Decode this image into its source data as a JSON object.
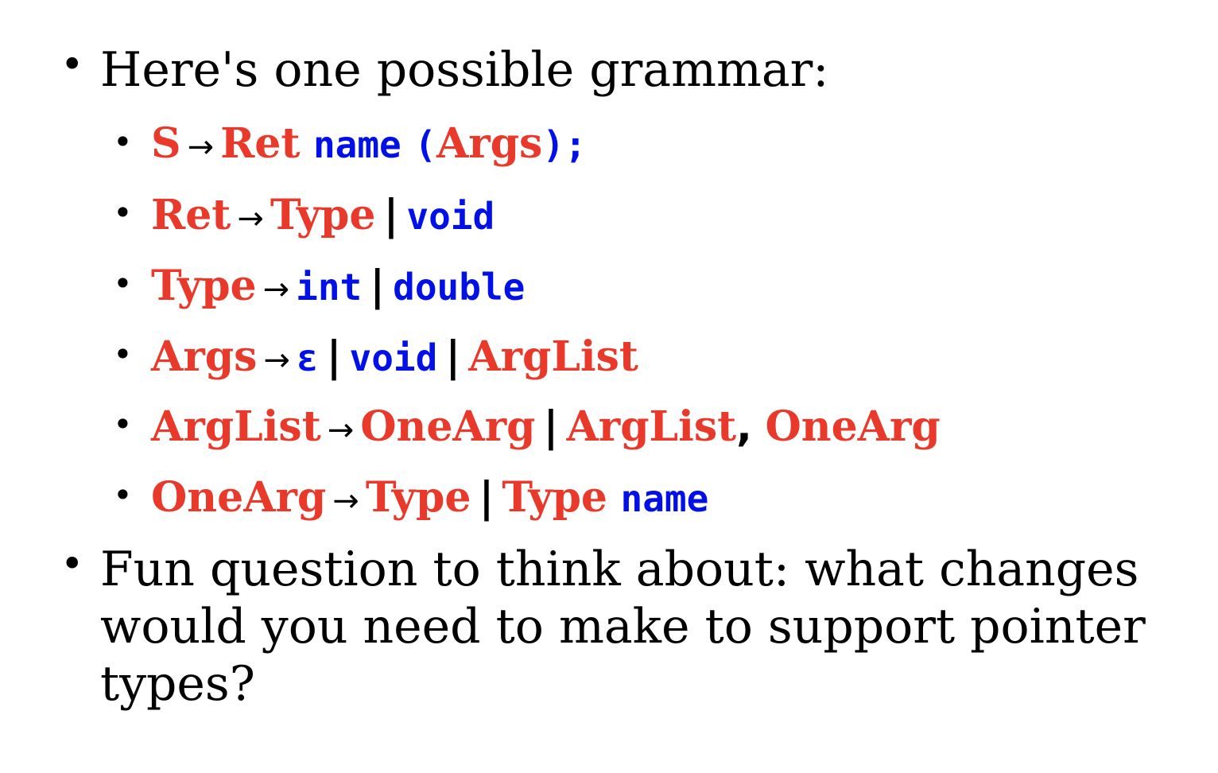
{
  "bullets": {
    "intro": "Here's one possible grammar:",
    "question": "Fun question to think about: what changes would you need to make to support pointer types?"
  },
  "grammar": {
    "arrow": "→",
    "bar": "|",
    "comma": ",",
    "rule1": {
      "lhs": "S",
      "ret": "Ret",
      "name": "name",
      "lparen": "(",
      "args": "Args",
      "rparen": ");"
    },
    "rule2": {
      "lhs": "Ret",
      "type": "Type",
      "void": "void"
    },
    "rule3": {
      "lhs": "Type",
      "int": "int",
      "double": "double"
    },
    "rule4": {
      "lhs": "Args",
      "eps": "ε",
      "void": "void",
      "arglist": "ArgList"
    },
    "rule5": {
      "lhs": "ArgList",
      "onearg": "OneArg",
      "arglist": "ArgList",
      "onearg2": "OneArg"
    },
    "rule6": {
      "lhs": "OneArg",
      "type": "Type",
      "type2": "Type",
      "name": "name"
    }
  },
  "colors": {
    "nonterminal": "#e8392b",
    "terminal": "#0010e6"
  }
}
